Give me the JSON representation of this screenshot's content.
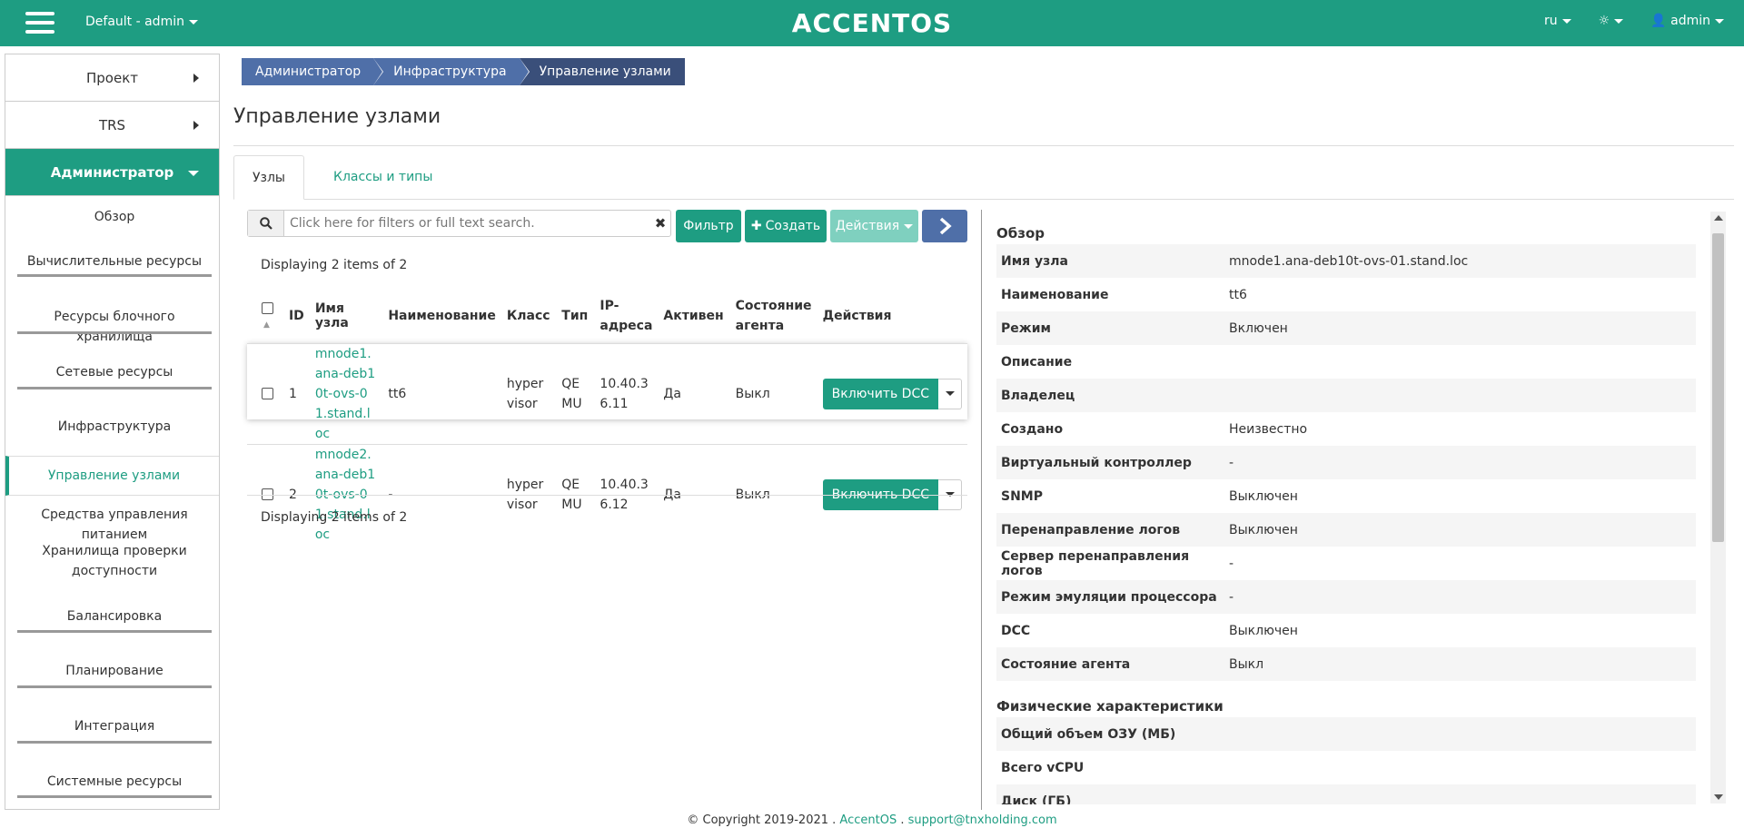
{
  "topbar": {
    "project": "Default - admin",
    "logo": "ACCENTOS",
    "lang": "ru",
    "user": "admin"
  },
  "sidebar": {
    "sections": [
      {
        "label": "Проект"
      },
      {
        "label": "TRS"
      },
      {
        "label": "Администратор"
      }
    ],
    "items": [
      "Обзор",
      "Вычислительные ресурсы",
      "Ресурсы блочного хранилища",
      "Сетевые ресурсы",
      "Инфраструктура",
      "Управление узлами",
      "Средства управления питанием",
      "Хранилища проверки доступности",
      "Балансировка",
      "Планирование",
      "Интеграция",
      "Системные ресурсы"
    ]
  },
  "breadcrumb": [
    "Администратор",
    "Инфраструктура",
    "Управление узлами"
  ],
  "page_title": "Управление узлами",
  "tabs": [
    "Узлы",
    "Классы и типы"
  ],
  "toolbar": {
    "search_placeholder": "Click here for filters or full text search.",
    "filter": "Фильтр",
    "create": "Создать",
    "actions": "Действия"
  },
  "table": {
    "displaying": "Displaying 2 items of 2",
    "columns": [
      "ID",
      "Имя узла",
      "Наименование",
      "Класс",
      "Тип",
      "IP-адреса",
      "Активен",
      "Состояние агента",
      "Действия"
    ],
    "rows": [
      {
        "id": "1",
        "name": "mnode1.ana-deb10t-ovs-01.stand.loc",
        "title": "tt6",
        "class": "hypervisor",
        "type": "QEMU",
        "ip": "10.40.36.11",
        "active": "Да",
        "agent": "Выкл",
        "action": "Включить DCC"
      },
      {
        "id": "2",
        "name": "mnode2.ana-deb10t-ovs-01.stand.loc",
        "title": "-",
        "class": "hypervisor",
        "type": "QEMU",
        "ip": "10.40.36.12",
        "active": "Да",
        "agent": "Выкл",
        "action": "Включить DCC"
      }
    ]
  },
  "detail": {
    "overview_title": "Обзор",
    "overview": [
      {
        "k": "Имя узла",
        "v": "mnode1.ana-deb10t-ovs-01.stand.loc"
      },
      {
        "k": "Наименование",
        "v": "tt6"
      },
      {
        "k": "Режим",
        "v": "Включен"
      },
      {
        "k": "Описание",
        "v": ""
      },
      {
        "k": "Владелец",
        "v": ""
      },
      {
        "k": "Создано",
        "v": "Неизвестно"
      },
      {
        "k": "Виртуальный контроллер",
        "v": "-"
      },
      {
        "k": "SNMP",
        "v": "Выключен"
      },
      {
        "k": "Перенаправление логов",
        "v": "Выключен"
      },
      {
        "k": "Сервер перенаправления логов",
        "v": "-"
      },
      {
        "k": "Режим эмуляции процессора",
        "v": "-"
      },
      {
        "k": "DCC",
        "v": "Выключен"
      },
      {
        "k": "Состояние агента",
        "v": "Выкл"
      }
    ],
    "physical_title": "Физические характеристики",
    "physical": [
      {
        "k": "Общий объем ОЗУ (МБ)",
        "v": ""
      },
      {
        "k": "Всего vCPU",
        "v": ""
      },
      {
        "k": "Диск (ГБ)",
        "v": ""
      }
    ]
  },
  "footer": {
    "copyright": "© Copyright 2019-2021 .",
    "brand": "AccentOS",
    "sep": ".",
    "email": "support@tnxholding.com"
  }
}
